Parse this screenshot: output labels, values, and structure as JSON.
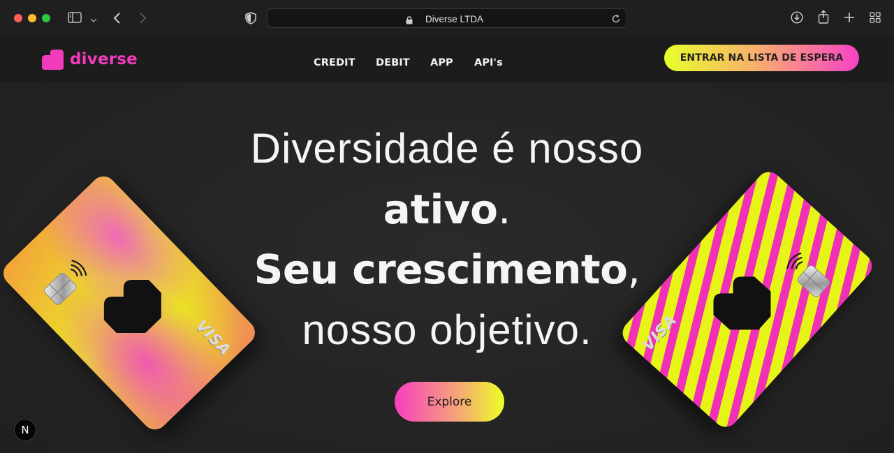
{
  "browser": {
    "url": "Diverse LTDA"
  },
  "site": {
    "logo_text": "diverse",
    "nav": [
      "CREDIT",
      "DEBIT",
      "APP",
      "API's"
    ],
    "waitlist_label": "ENTRAR NA LISTA DE ESPERA"
  },
  "hero": {
    "line1": "Diversidade é nosso",
    "line2_bold": "ativo",
    "line2_rest": ".",
    "line3_bold": "Seu crescimento",
    "line3_rest": ",",
    "line4": "nosso objetivo.",
    "explore_label": "Explore"
  },
  "cards": {
    "brand": "VISA",
    "left_variant": "Gold",
    "right_variant": "Debit"
  },
  "badge": {
    "label": "N"
  },
  "colors": {
    "brand_pink": "#f23bbc",
    "brand_yellow": "#e8ff2a",
    "background": "#232323"
  }
}
